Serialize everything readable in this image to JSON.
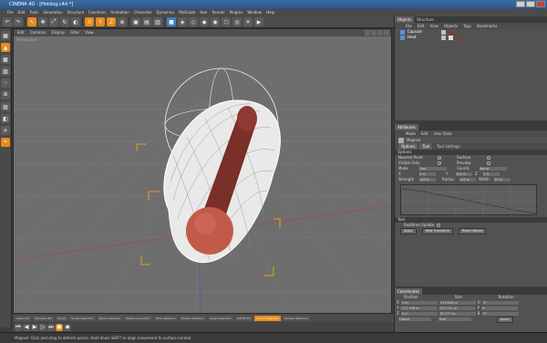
{
  "window": {
    "title": "CINEMA 4D - [Hotdog.c4d *]"
  },
  "menu": [
    "File",
    "Edit",
    "Tools",
    "Simulation",
    "Structure",
    "Functions",
    "Animation",
    "Character",
    "Dynamics",
    "MoGraph",
    "Hair",
    "Render",
    "Plugins",
    "Window",
    "Help"
  ],
  "viewport": {
    "menu": [
      "Edit",
      "Cameras",
      "Display",
      "Filter",
      "View"
    ],
    "label": "Perspective"
  },
  "object_manager": {
    "tabs": [
      "Objects",
      "Structure"
    ],
    "menu": [
      "File",
      "Edit",
      "View",
      "Objects",
      "Tags",
      "Bookmarks"
    ],
    "objects": [
      {
        "name": "Capsule"
      },
      {
        "name": "Heat"
      }
    ]
  },
  "attribute_manager": {
    "tab": "Attributes",
    "menu": [
      "Mode",
      "Edit",
      "User Data"
    ],
    "title": "Magnet",
    "subtabs": [
      "Options",
      "Tool",
      "Tool Settings"
    ],
    "options_header": "Options",
    "fields": {
      "nearest_point": "Nearest Point",
      "surface": "Surface",
      "visible_only": "Visible Only",
      "preview": "Preview",
      "mode": "Mode",
      "mode_value": "Dim",
      "coords": "Coords",
      "coords_value": "World",
      "x": "X",
      "y": "Y",
      "z": "Z",
      "x_val": "0 %",
      "y_val": "100 %",
      "z_val": "0 %",
      "strength": "Strength",
      "strength_val": "100 %",
      "radius": "Radius",
      "radius_val": "100 m",
      "width": "Width",
      "width_val": "50 %"
    },
    "tool_header": "Tool",
    "realtime_update": "Realtime Update",
    "buttons": [
      "Apply",
      "New Transform",
      "Reset Values"
    ]
  },
  "coordinates": {
    "tab": "Coordinates",
    "headers": [
      "Position",
      "Size",
      "Rotation"
    ],
    "rows": [
      {
        "axis": "X",
        "pos": "0 m",
        "size": "117.645 m",
        "rot_axis": "H",
        "rot": "0°"
      },
      {
        "axis": "Y",
        "pos": "171.798 m",
        "size": "117.711 m",
        "rot_axis": "P",
        "rot": "0°"
      },
      {
        "axis": "Z",
        "pos": "0 m",
        "size": "97.777 m",
        "rot_axis": "B",
        "rot": "0°"
      }
    ],
    "mode_value": "Object",
    "size_mode": "Size",
    "apply": "Apply"
  },
  "layout_tabs": [
    "Select All",
    "Standard #3",
    "Sculpt",
    "Sculpt Selection",
    "Rendr Selection",
    "Model Connection",
    "Hide Selection",
    "Unhide Selection",
    "Invert Selection",
    "UVEdit #3",
    "Cursor Selection",
    "Camera Selection"
  ],
  "status": "Magnet: Click and drag to deform points. Hold down SHIFT to align movement to surface normal."
}
